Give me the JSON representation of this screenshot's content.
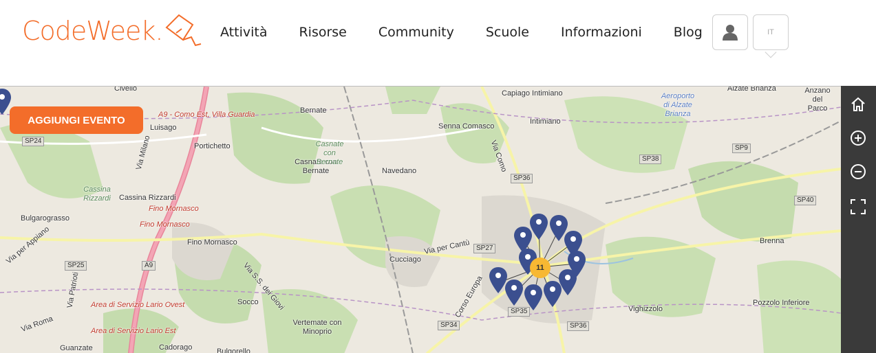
{
  "header": {
    "logo_text": "CodeWeek.",
    "nav": [
      "Attività",
      "Risorse",
      "Community",
      "Scuole",
      "Informazioni",
      "Blog"
    ],
    "lang_label": "IT"
  },
  "map": {
    "add_event_label": "AGGIUNGI EVENTO",
    "cluster_count": "11",
    "places": [
      "Capiago Intimiano",
      "Intimiano",
      "Senna Comasco",
      "Bernate",
      "Casnate con Bernate",
      "Navedano",
      "Portichetto",
      "Luisago",
      "Cassina Rizzardi",
      "Bulgarograsso",
      "Fino Mornasco",
      "Cucciago",
      "Socco",
      "Vertemate con Minoprio",
      "Cadorago",
      "Guanzate",
      "Vighizzolo",
      "Brenna",
      "Pozzolo Inferiore",
      "Alzate Brianza",
      "Anzano del Parco",
      "Civello",
      "Bulgorello"
    ],
    "roads": [
      "SP24",
      "SP25",
      "SP27",
      "SP34",
      "SP35",
      "SP36",
      "SP36",
      "SP38",
      "SP40",
      "SP9",
      "A9",
      "SP36"
    ],
    "red_labels": [
      "A9 - Como Est, Villa Guardia",
      "Fino Mornasco",
      "Fino Mornasco",
      "Area di Servizio Lario Ovest",
      "Area di Servizio Lario Est"
    ],
    "green_labels": [
      "Cassina Rizzardi",
      "Casnate con Bernate"
    ],
    "blue_labels": [
      "Aeroporto di Alzate Brianza"
    ],
    "street_labels": [
      "Via per Cantù",
      "Via Como",
      "Corso Europa",
      "Via S.S. dei Giovi",
      "Via per Appiano",
      "Via Milano",
      "Via Patrioti",
      "Via Roma"
    ]
  },
  "controls": [
    "home-icon",
    "zoom-in-icon",
    "zoom-out-icon",
    "fullscreen-icon"
  ],
  "colors": {
    "accent": "#f36d2a",
    "cluster": "#f7b833",
    "pin": "#3b4f8f",
    "control_bg": "#3a3a3a"
  }
}
